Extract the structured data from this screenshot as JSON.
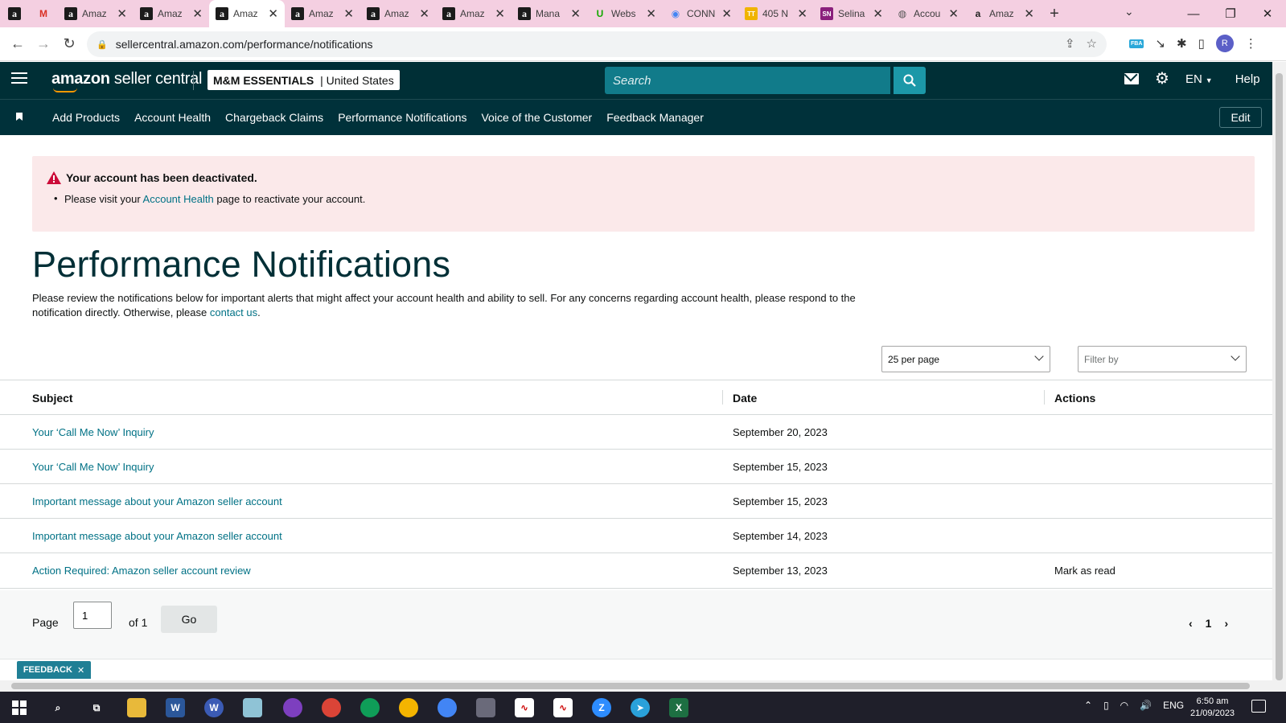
{
  "browser": {
    "tabs": [
      {
        "title": "",
        "icon": "amazon-a-icon",
        "pinned": true
      },
      {
        "title": "",
        "icon": "gmail-icon",
        "pinned": true
      },
      {
        "title": "Amaz",
        "icon": "amazon-a-icon"
      },
      {
        "title": "Amaz",
        "icon": "amazon-a-icon"
      },
      {
        "title": "Amaz",
        "icon": "amazon-a-icon",
        "active": true
      },
      {
        "title": "Amaz",
        "icon": "amazon-a-icon"
      },
      {
        "title": "Amaz",
        "icon": "amazon-a-icon"
      },
      {
        "title": "Amaz",
        "icon": "amazon-a-icon"
      },
      {
        "title": "Mana",
        "icon": "amazon-a-icon"
      },
      {
        "title": "Webs",
        "icon": "upwork-icon"
      },
      {
        "title": "CONN",
        "icon": "chrome-icon"
      },
      {
        "title": "405 N",
        "icon": "tt-icon"
      },
      {
        "title": "Selina",
        "icon": "sn-icon"
      },
      {
        "title": "Accou",
        "icon": "globe-icon"
      },
      {
        "title": "Amaz",
        "icon": "amazon-smile-icon"
      }
    ],
    "url": "sellercentral.amazon.com/performance/notifications",
    "profile_initial": "R",
    "fba_badge": "FBA"
  },
  "header": {
    "logo_brand": "amazon",
    "logo_suffix": " seller central",
    "store_name": "M&M ESSENTIALS",
    "store_sep": " | ",
    "marketplace": "United States",
    "search_placeholder": "Search",
    "language": "EN",
    "help": "Help"
  },
  "nav": {
    "items": [
      "Add Products",
      "Account Health",
      "Chargeback Claims",
      "Performance Notifications",
      "Voice of the Customer",
      "Feedback Manager"
    ],
    "edit": "Edit"
  },
  "alert": {
    "title": "Your account has been deactivated.",
    "body_prefix": "Please visit your ",
    "body_link": "Account Health",
    "body_suffix": " page to reactivate your account."
  },
  "page": {
    "title": "Performance Notifications",
    "intro_text": "Please review the notifications below for important alerts that might affect your account health and ability to sell. For any concerns regarding account health, please respond to the notification directly. Otherwise, please ",
    "intro_link": "contact us",
    "intro_end": "."
  },
  "controls": {
    "per_page": "25 per page",
    "filter_placeholder": "Filter by"
  },
  "table": {
    "headers": [
      "Subject",
      "Date",
      "Actions"
    ],
    "rows": [
      {
        "subject": "Your ‘Call Me Now’ Inquiry",
        "date": "September 20, 2023",
        "action": ""
      },
      {
        "subject": "Your ‘Call Me Now’ Inquiry",
        "date": "September 15, 2023",
        "action": ""
      },
      {
        "subject": "Important message about your Amazon seller account",
        "date": "September 15, 2023",
        "action": ""
      },
      {
        "subject": "Important message about your Amazon seller account",
        "date": "September 14, 2023",
        "action": ""
      },
      {
        "subject": "Action Required: Amazon seller account review",
        "date": "September 13, 2023",
        "action": "Mark as read"
      }
    ]
  },
  "pagination": {
    "page_label": "Page",
    "current": "1",
    "of_label": "of 1",
    "go": "Go",
    "page_number": "1"
  },
  "footer": {
    "feedback": "FEEDBACK"
  },
  "taskbar": {
    "language": "ENG",
    "time": "6:50 am",
    "date": "21/09/2023"
  }
}
